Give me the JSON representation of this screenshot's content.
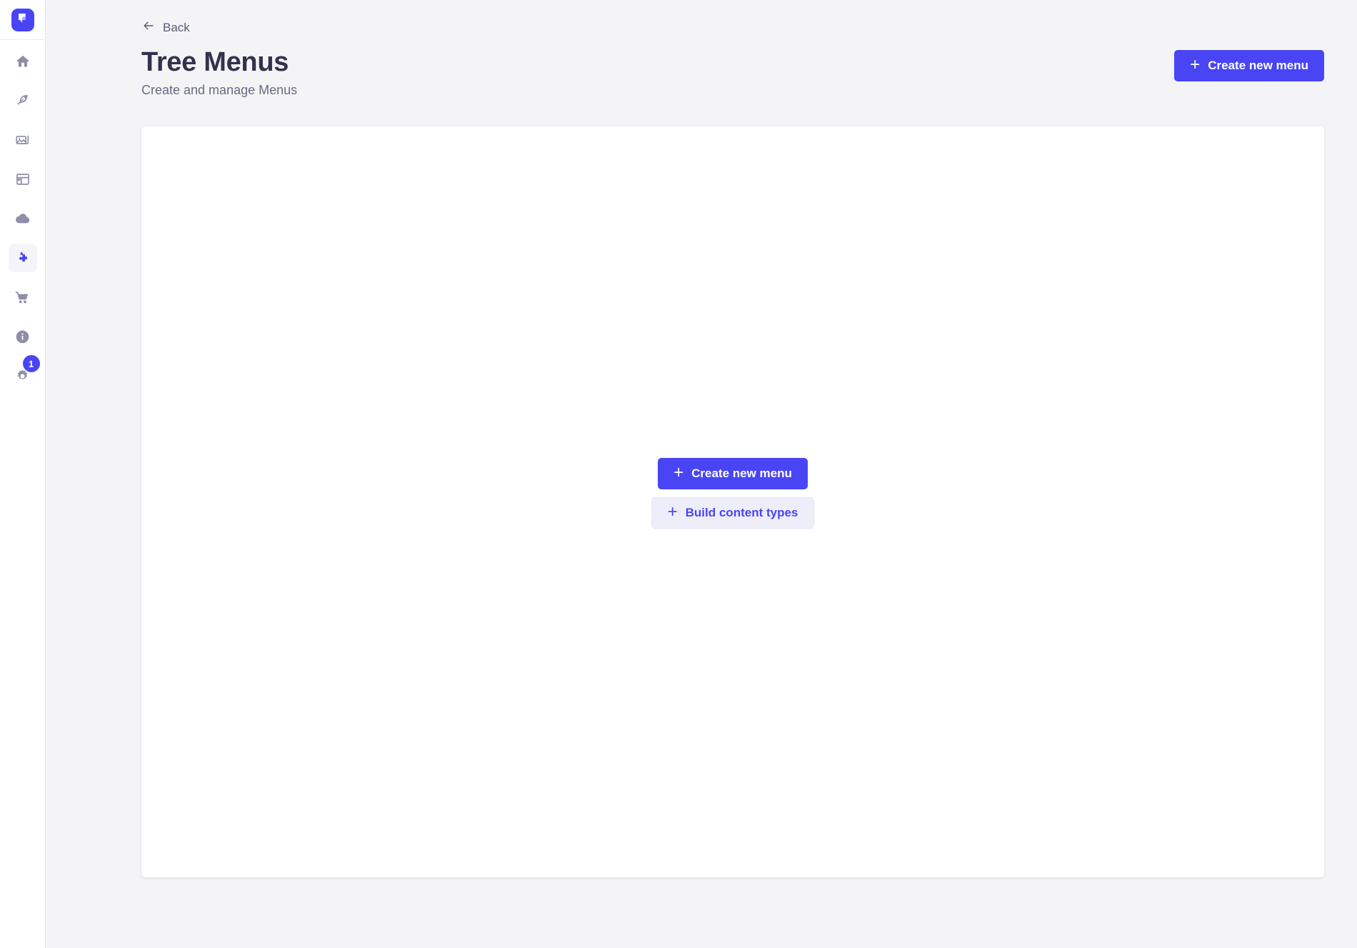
{
  "app": {
    "logo_icon": "strapi-logo-icon",
    "accent_color": "#4945f5",
    "background_color": "#f4f4f6",
    "card_color": "#ffffff",
    "title_color": "#32324d"
  },
  "sidebar": {
    "items": [
      {
        "icon": "home-icon",
        "name": "sidebar-item-home",
        "active": false
      },
      {
        "icon": "feather-icon",
        "name": "sidebar-item-content-manager",
        "active": false
      },
      {
        "icon": "images-icon",
        "name": "sidebar-item-media-library",
        "active": false
      },
      {
        "icon": "layout-icon",
        "name": "sidebar-item-content-type-builder",
        "active": false
      },
      {
        "icon": "cloud-icon",
        "name": "sidebar-item-cloud",
        "active": false
      },
      {
        "icon": "puzzle-icon",
        "name": "sidebar-item-plugins",
        "active": true
      },
      {
        "icon": "cart-icon",
        "name": "sidebar-item-marketplace",
        "active": false
      },
      {
        "icon": "info-icon",
        "name": "sidebar-item-info",
        "active": false
      },
      {
        "icon": "gear-icon",
        "name": "sidebar-item-settings",
        "active": false,
        "badge": "1"
      }
    ]
  },
  "header": {
    "back_label": "Back",
    "back_icon": "arrow-left-icon",
    "title": "Tree Menus",
    "subtitle": "Create and manage Menus",
    "create_button_label": "Create new menu",
    "create_button_icon": "plus-icon"
  },
  "main": {
    "empty_state": {
      "primary_button_label": "Create new menu",
      "primary_button_icon": "plus-icon",
      "secondary_button_label": "Build content types",
      "secondary_button_icon": "plus-icon"
    }
  }
}
